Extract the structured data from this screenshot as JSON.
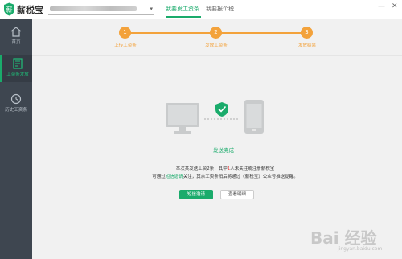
{
  "app": {
    "name": "薪税宝",
    "logo_glyph": "薪",
    "company_select": {
      "value": "",
      "caret": "▾"
    }
  },
  "top_tabs": [
    {
      "label": "我要发工资条",
      "active": true
    },
    {
      "label": "我要报个税",
      "active": false
    }
  ],
  "window_controls": {
    "minimize": "—",
    "close": "✕"
  },
  "sidebar": {
    "items": [
      {
        "label": "首页",
        "icon": "home-icon",
        "active": false
      },
      {
        "label": "工资条发放",
        "icon": "payslip-icon",
        "active": true
      },
      {
        "label": "历史工资条",
        "icon": "history-icon",
        "active": false
      }
    ]
  },
  "steps": [
    {
      "number": "1",
      "label": "上传工资条"
    },
    {
      "number": "2",
      "label": "发放工资条"
    },
    {
      "number": "3",
      "label": "发放结果"
    }
  ],
  "result": {
    "status": "发送完成",
    "line1_prefix": "本次共发送工资2条，其中",
    "line1_count": "1",
    "line1_suffix": "人未关注或注册薪税宝",
    "line2_prefix": "可通过",
    "line2_link": "短信邀请",
    "line2_suffix": "关注，其余工资条稍后将通过《薪税宝》公众号推送提醒。"
  },
  "actions": {
    "primary": "短信邀请",
    "secondary": "查看明细"
  },
  "watermark": {
    "text": "Bai 经验",
    "sub": "jingyan.baidu.com"
  },
  "colors": {
    "brand_green": "#1aab6b",
    "step_orange": "#f3a23b",
    "sidebar_bg": "#3e4650"
  }
}
